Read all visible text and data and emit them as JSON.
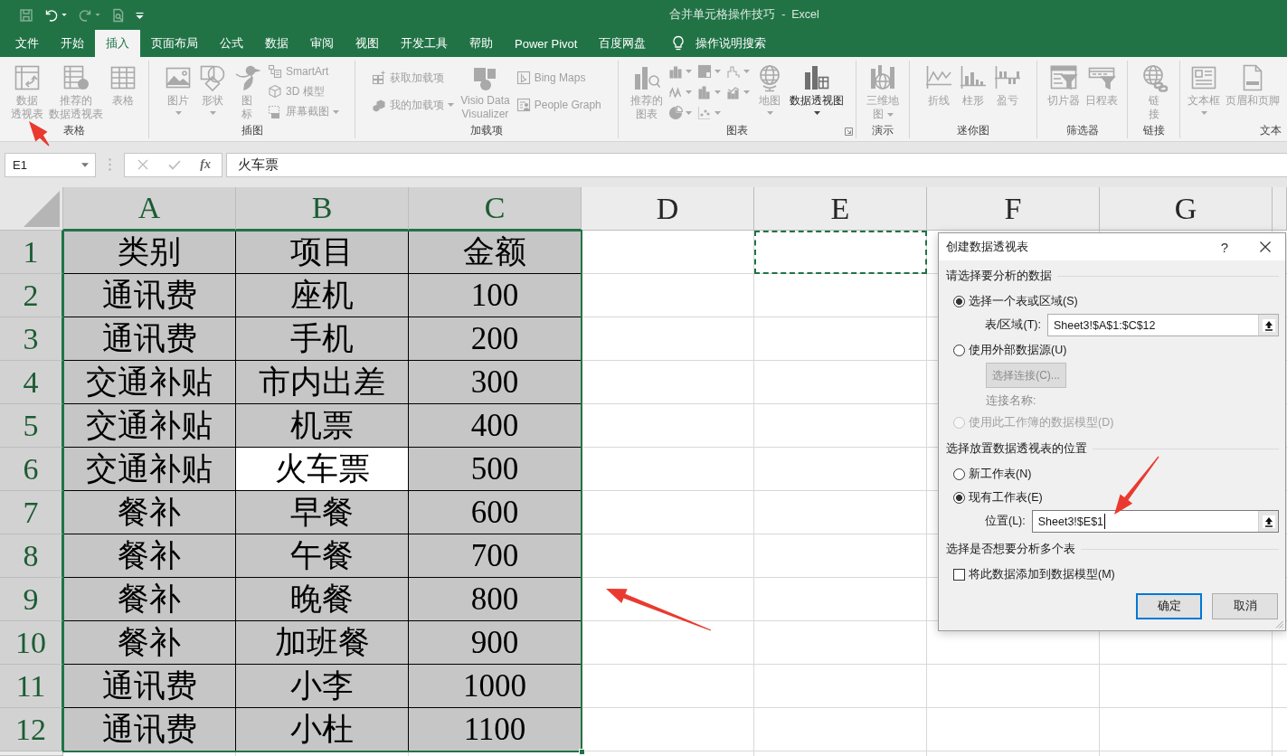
{
  "title_bar": {
    "quick_access": [
      {
        "disabled": true,
        "dropdown": false
      },
      {
        "disabled": false,
        "dropdown": true
      },
      {
        "disabled": true,
        "dropdown": true
      },
      {
        "disabled": true,
        "dropdown": false
      }
    ],
    "title": "合并单元格操作技巧  -  Excel"
  },
  "tabs": [
    {
      "label": "文件",
      "selected": false
    },
    {
      "label": "开始",
      "selected": false
    },
    {
      "label": "插入",
      "selected": true
    },
    {
      "label": "页面布局",
      "selected": false
    },
    {
      "label": "公式",
      "selected": false
    },
    {
      "label": "数据",
      "selected": false
    },
    {
      "label": "审阅",
      "selected": false
    },
    {
      "label": "视图",
      "selected": false
    },
    {
      "label": "开发工具",
      "selected": false
    },
    {
      "label": "帮助",
      "selected": false
    },
    {
      "label": "Power Pivot",
      "selected": false
    },
    {
      "label": "百度网盘",
      "selected": false
    }
  ],
  "tell_me": {
    "label": "操作说明搜索"
  },
  "ribbon": {
    "groups": [
      {
        "label": "表格",
        "items": [
          {
            "kind": "large",
            "lines": [
              "数据",
              "透视表"
            ],
            "disabled": true,
            "dropdown": false
          },
          {
            "kind": "large",
            "lines": [
              "推荐的",
              "数据透视表"
            ],
            "disabled": true,
            "dropdown": false
          },
          {
            "kind": "large",
            "lines": [
              "表格"
            ],
            "disabled": true,
            "dropdown": false
          }
        ]
      },
      {
        "label": "插图",
        "items": [
          {
            "kind": "large",
            "lines": [
              "图片"
            ],
            "disabled": true,
            "dropdown": true
          },
          {
            "kind": "large",
            "lines": [
              "形状"
            ],
            "disabled": true,
            "dropdown": true
          },
          {
            "kind": "large",
            "lines": [
              "图",
              "标"
            ],
            "disabled": true,
            "dropdown": false
          },
          {
            "kind": "stack",
            "items": [
              {
                "kind": "small",
                "label": "SmartArt",
                "disabled": true,
                "dropdown": false
              },
              {
                "kind": "small",
                "label": "3D 模型",
                "disabled": true,
                "dropdown": false
              },
              {
                "kind": "small",
                "label": "屏幕截图",
                "disabled": true,
                "dropdown": true
              }
            ]
          }
        ]
      },
      {
        "label": "加载项",
        "items": [
          {
            "kind": "stack",
            "items": [
              {
                "kind": "small",
                "label": "获取加载项",
                "disabled": true,
                "dropdown": false
              },
              {
                "kind": "small",
                "label": "我的加载项",
                "disabled": true,
                "dropdown": true
              }
            ]
          },
          {
            "kind": "large",
            "lines": [
              "Visio Data",
              "Visualizer"
            ],
            "disabled": true,
            "dropdown": false
          },
          {
            "kind": "stack",
            "items": [
              {
                "kind": "small",
                "label": "Bing Maps",
                "disabled": true,
                "dropdown": false
              },
              {
                "kind": "small",
                "label": "People Graph",
                "disabled": true,
                "dropdown": false
              }
            ]
          }
        ]
      },
      {
        "label": "图表",
        "dialog_launcher": true,
        "items": [
          {
            "kind": "large",
            "lines": [
              "推荐的",
              "图表"
            ],
            "disabled": true,
            "dropdown": false
          },
          {
            "kind": "stack",
            "items": [
              {
                "kind": "icon",
                "disabled": true,
                "dropdown": true
              },
              {
                "kind": "icon",
                "disabled": true,
                "dropdown": true
              },
              {
                "kind": "icon",
                "disabled": true,
                "dropdown": true
              }
            ]
          },
          {
            "kind": "stack",
            "items": [
              {
                "kind": "icon",
                "disabled": true,
                "dropdown": true
              },
              {
                "kind": "icon",
                "disabled": true,
                "dropdown": true
              },
              {
                "kind": "icon",
                "disabled": true,
                "dropdown": true
              }
            ]
          },
          {
            "kind": "stack",
            "items": [
              {
                "kind": "icon",
                "disabled": true,
                "dropdown": true
              },
              {
                "kind": "icon",
                "disabled": true,
                "dropdown": true
              }
            ]
          },
          {
            "kind": "large",
            "lines": [
              "地图"
            ],
            "disabled": true,
            "dropdown": true
          },
          {
            "kind": "large",
            "lines": [
              "数据透视图"
            ],
            "disabled": false,
            "dropdown": true
          }
        ]
      },
      {
        "label": "演示",
        "items": [
          {
            "kind": "large",
            "lines": [
              "三维地",
              "图"
            ],
            "disabled": true,
            "dropdown": true
          }
        ]
      },
      {
        "label": "迷你图",
        "items": [
          {
            "kind": "large",
            "lines": [
              "折线"
            ],
            "disabled": true,
            "dropdown": false
          },
          {
            "kind": "large",
            "lines": [
              "柱形"
            ],
            "disabled": true,
            "dropdown": false
          },
          {
            "kind": "large",
            "lines": [
              "盈亏"
            ],
            "disabled": true,
            "dropdown": false
          }
        ]
      },
      {
        "label": "筛选器",
        "items": [
          {
            "kind": "large",
            "lines": [
              "切片器"
            ],
            "disabled": true,
            "dropdown": false
          },
          {
            "kind": "large",
            "lines": [
              "日程表"
            ],
            "disabled": true,
            "dropdown": false
          }
        ]
      },
      {
        "label": "链接",
        "items": [
          {
            "kind": "large",
            "lines": [
              "链",
              "接"
            ],
            "disabled": true,
            "dropdown": false
          }
        ]
      },
      {
        "label": "文本",
        "items": [
          {
            "kind": "large",
            "lines": [
              "文本框"
            ],
            "disabled": true,
            "dropdown": true
          },
          {
            "kind": "large",
            "lines": [
              "页眉和页脚"
            ],
            "disabled": true,
            "dropdown": false
          }
        ]
      }
    ]
  },
  "formula_bar": {
    "name_box": "E1",
    "insert_function": "fx",
    "value": "火车票"
  },
  "sheet": {
    "columns": [
      {
        "label": "A",
        "selected": true,
        "marquee": false
      },
      {
        "label": "B",
        "selected": true,
        "marquee": false
      },
      {
        "label": "C",
        "selected": true,
        "marquee": false
      },
      {
        "label": "D",
        "selected": false,
        "marquee": false
      },
      {
        "label": "E",
        "selected": false,
        "marquee": true
      },
      {
        "label": "F",
        "selected": false,
        "marquee": false
      },
      {
        "label": "G",
        "selected": false,
        "marquee": false
      }
    ],
    "rows": [
      {
        "label": "1",
        "selected": true,
        "cells": [
          {
            "text": "类别",
            "active": false
          },
          {
            "text": "项目",
            "active": false
          },
          {
            "text": "金额",
            "active": false
          }
        ]
      },
      {
        "label": "2",
        "selected": true,
        "cells": [
          {
            "text": "通讯费",
            "active": false
          },
          {
            "text": "座机",
            "active": false
          },
          {
            "text": "100",
            "active": false
          }
        ]
      },
      {
        "label": "3",
        "selected": true,
        "cells": [
          {
            "text": "通讯费",
            "active": false
          },
          {
            "text": "手机",
            "active": false
          },
          {
            "text": "200",
            "active": false
          }
        ]
      },
      {
        "label": "4",
        "selected": true,
        "cells": [
          {
            "text": "交通补贴",
            "active": false
          },
          {
            "text": "市内出差",
            "active": false
          },
          {
            "text": "300",
            "active": false
          }
        ]
      },
      {
        "label": "5",
        "selected": true,
        "cells": [
          {
            "text": "交通补贴",
            "active": false
          },
          {
            "text": "机票",
            "active": false
          },
          {
            "text": "400",
            "active": false
          }
        ]
      },
      {
        "label": "6",
        "selected": true,
        "cells": [
          {
            "text": "交通补贴",
            "active": false
          },
          {
            "text": "火车票",
            "active": true
          },
          {
            "text": "500",
            "active": false
          }
        ]
      },
      {
        "label": "7",
        "selected": true,
        "cells": [
          {
            "text": "餐补",
            "active": false
          },
          {
            "text": "早餐",
            "active": false
          },
          {
            "text": "600",
            "active": false
          }
        ]
      },
      {
        "label": "8",
        "selected": true,
        "cells": [
          {
            "text": "餐补",
            "active": false
          },
          {
            "text": "午餐",
            "active": false
          },
          {
            "text": "700",
            "active": false
          }
        ]
      },
      {
        "label": "9",
        "selected": true,
        "cells": [
          {
            "text": "餐补",
            "active": false
          },
          {
            "text": "晚餐",
            "active": false
          },
          {
            "text": "800",
            "active": false
          }
        ]
      },
      {
        "label": "10",
        "selected": true,
        "cells": [
          {
            "text": "餐补",
            "active": false
          },
          {
            "text": "加班餐",
            "active": false
          },
          {
            "text": "900",
            "active": false
          }
        ]
      },
      {
        "label": "11",
        "selected": true,
        "cells": [
          {
            "text": "通讯费",
            "active": false
          },
          {
            "text": "小李",
            "active": false
          },
          {
            "text": "1000",
            "active": false
          }
        ]
      },
      {
        "label": "12",
        "selected": true,
        "cells": [
          {
            "text": "通讯费",
            "active": false
          },
          {
            "text": "小杜",
            "active": false
          },
          {
            "text": "1100",
            "active": false
          }
        ]
      }
    ]
  },
  "dialog": {
    "title": "创建数据透视表",
    "help": "?",
    "sections": [
      {
        "heading": "请选择要分析的数据",
        "rows": [
          {
            "kind": "radio",
            "label": "选择一个表或区域(S)",
            "selected": true,
            "disabled": false
          },
          {
            "kind": "field",
            "label": "表/区域(T):",
            "value": "Sheet3!$A$1:$C$12",
            "focused": false
          },
          {
            "kind": "radio",
            "label": "使用外部数据源(U)",
            "selected": false,
            "disabled": false
          },
          {
            "kind": "button",
            "label": "选择连接(C)...",
            "disabled": true
          },
          {
            "kind": "note",
            "label": "连接名称:",
            "disabled": true
          },
          {
            "kind": "radio",
            "label": "使用此工作簿的数据模型(D)",
            "selected": false,
            "disabled": true
          }
        ]
      },
      {
        "heading": "选择放置数据透视表的位置",
        "rows": [
          {
            "kind": "radio",
            "label": "新工作表(N)",
            "selected": false,
            "disabled": false
          },
          {
            "kind": "radio",
            "label": "现有工作表(E)",
            "selected": true,
            "disabled": false
          },
          {
            "kind": "field",
            "label": "位置(L):",
            "value": "Sheet3!$E$1",
            "focused": true
          }
        ]
      },
      {
        "heading": "选择是否想要分析多个表",
        "rows": [
          {
            "kind": "checkbox",
            "label": "将此数据添加到数据模型(M)",
            "checked": false
          }
        ]
      }
    ],
    "buttons": [
      {
        "label": "确定",
        "default": true
      },
      {
        "label": "取消",
        "default": false
      }
    ]
  }
}
